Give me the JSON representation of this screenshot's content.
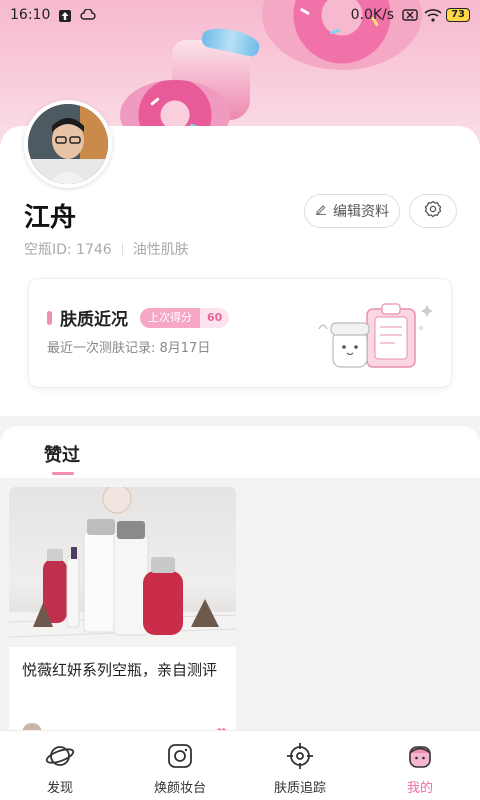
{
  "status_bar": {
    "time": "16:10",
    "network_speed": "0.0K/s",
    "battery": "73"
  },
  "profile": {
    "name": "江舟",
    "id_text": "空瓶ID: 1746",
    "skin_type": "油性肌肤",
    "edit_label": "编辑资料"
  },
  "skin_card": {
    "title": "肤质近况",
    "score_label": "上次得分",
    "score_value": "60",
    "subtitle": "最近一次测肤记录: 8月17日"
  },
  "tabs": {
    "liked": "赞过"
  },
  "feed": {
    "posts": [
      {
        "title": "悦薇红妍系列空瓶，亲自测评"
      }
    ]
  },
  "bottom_nav": {
    "items": [
      {
        "label": "发现",
        "icon": "planet-icon"
      },
      {
        "label": "焕颜妆台",
        "icon": "camera-icon"
      },
      {
        "label": "肤质追踪",
        "icon": "target-icon"
      },
      {
        "label": "我的",
        "icon": "profile-icon"
      }
    ],
    "active_color": "#f06ea6"
  },
  "colors": {
    "accent": "#f28db5",
    "banner": "#f6b9cf"
  }
}
